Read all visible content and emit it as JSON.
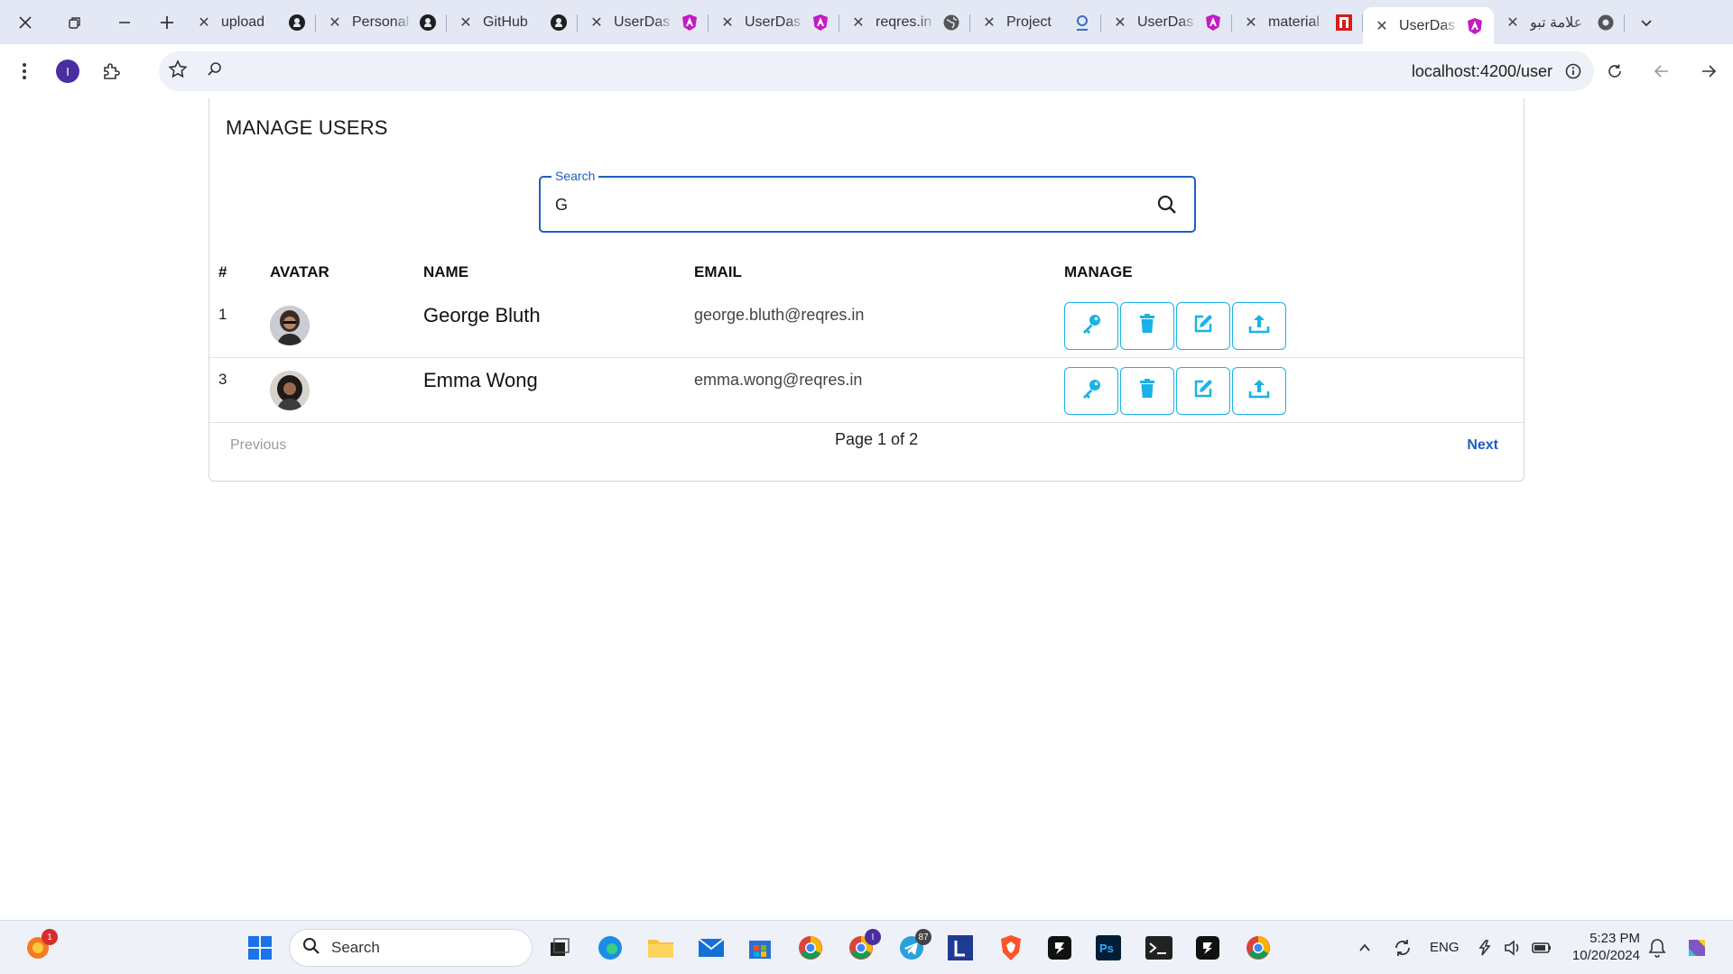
{
  "browser": {
    "tabs": [
      {
        "title": "upload",
        "favicon": "github-icon"
      },
      {
        "title": "Personal",
        "favicon": "github-icon"
      },
      {
        "title": "GitHub",
        "favicon": "github-icon"
      },
      {
        "title": "UserDas",
        "favicon": "angular-icon"
      },
      {
        "title": "UserDas",
        "favicon": "angular-icon"
      },
      {
        "title": "reqres.in",
        "favicon": "globe-icon"
      },
      {
        "title": "Project",
        "favicon": "project-icon"
      },
      {
        "title": "UserDas",
        "favicon": "angular-icon"
      },
      {
        "title": "material",
        "favicon": "material-icon"
      },
      {
        "title": "UserDas",
        "favicon": "angular-icon",
        "active": true
      },
      {
        "title": "علامة تبو",
        "favicon": "chrome-icon"
      }
    ],
    "profile_initial": "I",
    "url": "localhost:4200/user"
  },
  "page": {
    "title": "MANAGE USERS",
    "search": {
      "label": "Search",
      "value": "G"
    },
    "columns": [
      "#",
      "AVATAR",
      "NAME",
      "EMAIL",
      "MANAGE"
    ],
    "users": [
      {
        "id": "1",
        "name": "George Bluth",
        "email": "george.bluth@reqres.in"
      },
      {
        "id": "3",
        "name": "Emma Wong",
        "email": "emma.wong@reqres.in"
      }
    ],
    "manage_actions": [
      "key-icon",
      "trash-icon",
      "edit-icon",
      "upload-icon"
    ],
    "pager": {
      "previous": "Previous",
      "info": "Page 1 of 2",
      "next": "Next"
    }
  },
  "taskbar": {
    "search_placeholder": "Search",
    "notifications_badge": "1",
    "chrome_badge": "I",
    "telegram_badge": "87",
    "language": "ENG",
    "time": "5:23 PM",
    "date": "10/20/2024"
  },
  "colors": {
    "accent": "#1f5fbf",
    "manage_button": "#19b2e6",
    "tabstrip": "#e3e8f4"
  }
}
